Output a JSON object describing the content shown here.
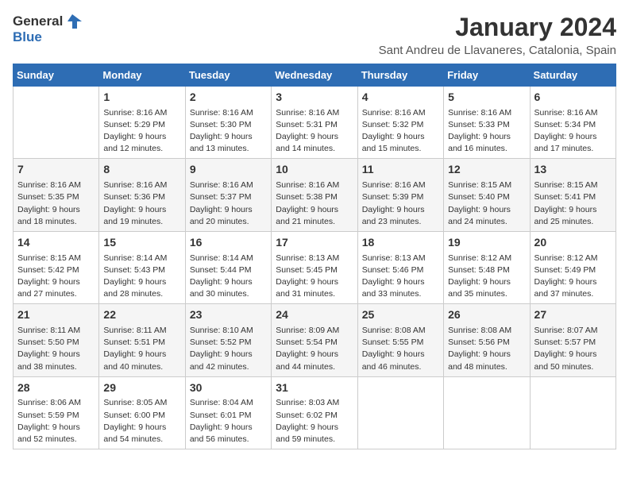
{
  "header": {
    "logo_line1": "General",
    "logo_line2": "Blue",
    "month": "January 2024",
    "location": "Sant Andreu de Llavaneres, Catalonia, Spain"
  },
  "days_of_week": [
    "Sunday",
    "Monday",
    "Tuesday",
    "Wednesday",
    "Thursday",
    "Friday",
    "Saturday"
  ],
  "weeks": [
    [
      {
        "day": "",
        "info": ""
      },
      {
        "day": "1",
        "info": "Sunrise: 8:16 AM\nSunset: 5:29 PM\nDaylight: 9 hours\nand 12 minutes."
      },
      {
        "day": "2",
        "info": "Sunrise: 8:16 AM\nSunset: 5:30 PM\nDaylight: 9 hours\nand 13 minutes."
      },
      {
        "day": "3",
        "info": "Sunrise: 8:16 AM\nSunset: 5:31 PM\nDaylight: 9 hours\nand 14 minutes."
      },
      {
        "day": "4",
        "info": "Sunrise: 8:16 AM\nSunset: 5:32 PM\nDaylight: 9 hours\nand 15 minutes."
      },
      {
        "day": "5",
        "info": "Sunrise: 8:16 AM\nSunset: 5:33 PM\nDaylight: 9 hours\nand 16 minutes."
      },
      {
        "day": "6",
        "info": "Sunrise: 8:16 AM\nSunset: 5:34 PM\nDaylight: 9 hours\nand 17 minutes."
      }
    ],
    [
      {
        "day": "7",
        "info": "Sunrise: 8:16 AM\nSunset: 5:35 PM\nDaylight: 9 hours\nand 18 minutes."
      },
      {
        "day": "8",
        "info": "Sunrise: 8:16 AM\nSunset: 5:36 PM\nDaylight: 9 hours\nand 19 minutes."
      },
      {
        "day": "9",
        "info": "Sunrise: 8:16 AM\nSunset: 5:37 PM\nDaylight: 9 hours\nand 20 minutes."
      },
      {
        "day": "10",
        "info": "Sunrise: 8:16 AM\nSunset: 5:38 PM\nDaylight: 9 hours\nand 21 minutes."
      },
      {
        "day": "11",
        "info": "Sunrise: 8:16 AM\nSunset: 5:39 PM\nDaylight: 9 hours\nand 23 minutes."
      },
      {
        "day": "12",
        "info": "Sunrise: 8:15 AM\nSunset: 5:40 PM\nDaylight: 9 hours\nand 24 minutes."
      },
      {
        "day": "13",
        "info": "Sunrise: 8:15 AM\nSunset: 5:41 PM\nDaylight: 9 hours\nand 25 minutes."
      }
    ],
    [
      {
        "day": "14",
        "info": "Sunrise: 8:15 AM\nSunset: 5:42 PM\nDaylight: 9 hours\nand 27 minutes."
      },
      {
        "day": "15",
        "info": "Sunrise: 8:14 AM\nSunset: 5:43 PM\nDaylight: 9 hours\nand 28 minutes."
      },
      {
        "day": "16",
        "info": "Sunrise: 8:14 AM\nSunset: 5:44 PM\nDaylight: 9 hours\nand 30 minutes."
      },
      {
        "day": "17",
        "info": "Sunrise: 8:13 AM\nSunset: 5:45 PM\nDaylight: 9 hours\nand 31 minutes."
      },
      {
        "day": "18",
        "info": "Sunrise: 8:13 AM\nSunset: 5:46 PM\nDaylight: 9 hours\nand 33 minutes."
      },
      {
        "day": "19",
        "info": "Sunrise: 8:12 AM\nSunset: 5:48 PM\nDaylight: 9 hours\nand 35 minutes."
      },
      {
        "day": "20",
        "info": "Sunrise: 8:12 AM\nSunset: 5:49 PM\nDaylight: 9 hours\nand 37 minutes."
      }
    ],
    [
      {
        "day": "21",
        "info": "Sunrise: 8:11 AM\nSunset: 5:50 PM\nDaylight: 9 hours\nand 38 minutes."
      },
      {
        "day": "22",
        "info": "Sunrise: 8:11 AM\nSunset: 5:51 PM\nDaylight: 9 hours\nand 40 minutes."
      },
      {
        "day": "23",
        "info": "Sunrise: 8:10 AM\nSunset: 5:52 PM\nDaylight: 9 hours\nand 42 minutes."
      },
      {
        "day": "24",
        "info": "Sunrise: 8:09 AM\nSunset: 5:54 PM\nDaylight: 9 hours\nand 44 minutes."
      },
      {
        "day": "25",
        "info": "Sunrise: 8:08 AM\nSunset: 5:55 PM\nDaylight: 9 hours\nand 46 minutes."
      },
      {
        "day": "26",
        "info": "Sunrise: 8:08 AM\nSunset: 5:56 PM\nDaylight: 9 hours\nand 48 minutes."
      },
      {
        "day": "27",
        "info": "Sunrise: 8:07 AM\nSunset: 5:57 PM\nDaylight: 9 hours\nand 50 minutes."
      }
    ],
    [
      {
        "day": "28",
        "info": "Sunrise: 8:06 AM\nSunset: 5:59 PM\nDaylight: 9 hours\nand 52 minutes."
      },
      {
        "day": "29",
        "info": "Sunrise: 8:05 AM\nSunset: 6:00 PM\nDaylight: 9 hours\nand 54 minutes."
      },
      {
        "day": "30",
        "info": "Sunrise: 8:04 AM\nSunset: 6:01 PM\nDaylight: 9 hours\nand 56 minutes."
      },
      {
        "day": "31",
        "info": "Sunrise: 8:03 AM\nSunset: 6:02 PM\nDaylight: 9 hours\nand 59 minutes."
      },
      {
        "day": "",
        "info": ""
      },
      {
        "day": "",
        "info": ""
      },
      {
        "day": "",
        "info": ""
      }
    ]
  ]
}
